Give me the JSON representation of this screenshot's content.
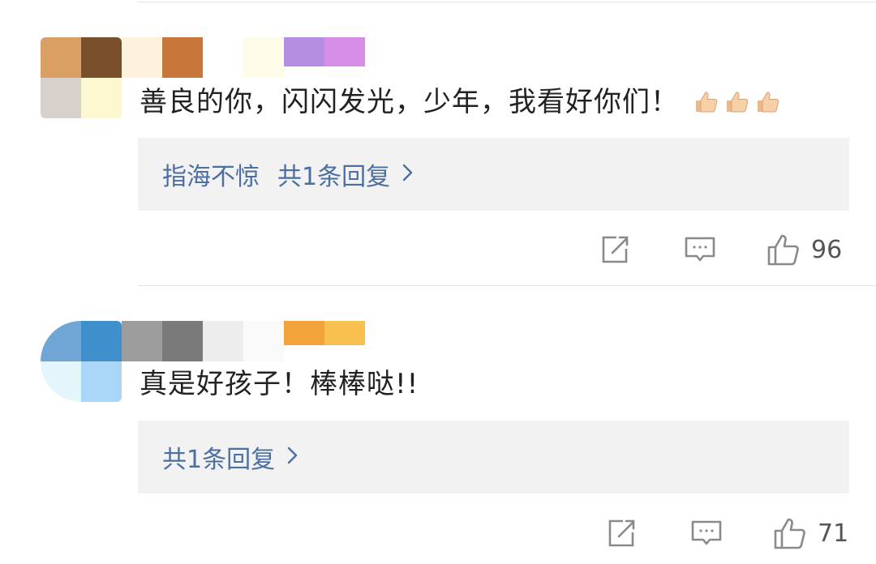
{
  "comments": [
    {
      "text": "善良的你，闪闪发光，少年，我看好你们！",
      "emoji_count": 3,
      "emoji": "thumbs-up-icon",
      "reply_preview": {
        "replier": "指海不惊",
        "summary": "共1条回复"
      },
      "actions": {
        "share_icon": "share-icon",
        "comment_icon": "comment-icon",
        "like_icon": "thumbs-up-icon",
        "like_count": "96"
      },
      "avatar_colors": [
        "#d99f63",
        "#7a4f2c",
        "#d8d0cb",
        "#fdf8cf"
      ],
      "name_colors": [
        "#fdf3dd",
        "#c9763a",
        "#ffffff",
        "#fefbe9"
      ],
      "badge_colors": [
        "#b48ee0",
        "#d78ee8"
      ]
    },
    {
      "text": "真是好孩子！棒棒哒!!",
      "reply_preview": {
        "replier": "",
        "summary": "共1条回复"
      },
      "actions": {
        "share_icon": "share-icon",
        "comment_icon": "comment-icon",
        "like_icon": "thumbs-up-icon",
        "like_count": "71"
      },
      "avatar_colors": [
        "#6fa6d6",
        "#3e8fcb",
        "#e4f6fb",
        "#a9d6f7"
      ],
      "name_colors": [
        "#9d9d9d",
        "#7a7a7a",
        "#ededed",
        "#fafafa"
      ],
      "badge_colors": [
        "#f2a43a",
        "#f8c04e"
      ]
    }
  ],
  "colors": {
    "reply_text": "#4a6fa0",
    "reply_bg": "#f2f2f2",
    "icon_gray": "#8a8a8a",
    "count_text": "#555555"
  }
}
